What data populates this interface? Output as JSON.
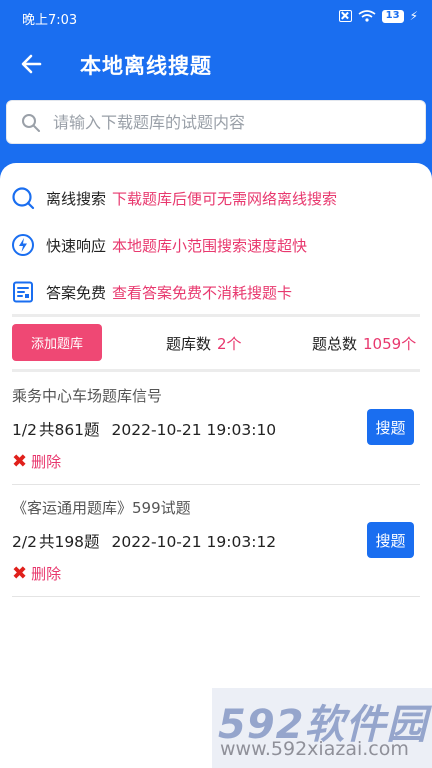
{
  "status_bar": {
    "time": "晚上7:03",
    "battery": "13"
  },
  "nav": {
    "title": "本地离线搜题"
  },
  "search": {
    "placeholder": "请输入下载题库的试题内容"
  },
  "features": [
    {
      "icon": "search-circle-icon",
      "name": "离线搜索",
      "desc": "下载题库后便可无需网络离线搜索"
    },
    {
      "icon": "lightning-icon",
      "name": "快速响应",
      "desc": "本地题库小范围搜索速度超快"
    },
    {
      "icon": "answer-sheet-icon",
      "name": "答案免费",
      "desc": "查看答案免费不消耗搜题卡"
    }
  ],
  "stats": {
    "add_label": "添加题库",
    "bank_count_label": "题库数",
    "bank_count_value": "2个",
    "total_label": "题总数",
    "total_value": "1059个"
  },
  "banks": [
    {
      "title": "乘务中心车场题库信号",
      "progress": "1/2",
      "count": "共861题",
      "datetime": "2022-10-21 19:03:10",
      "search_label": "搜题",
      "delete_label": "删除"
    },
    {
      "title": "《客运通用题库》599试题",
      "progress": "2/2",
      "count": "共198题",
      "datetime": "2022-10-21 19:03:12",
      "search_label": "搜题",
      "delete_label": "删除"
    }
  ],
  "watermark": {
    "logo": "592软件园",
    "url": "www.592xiazai.com"
  },
  "colors": {
    "primary": "#1a6ef0",
    "accent": "#e8386e",
    "add_button": "#ef4874",
    "delete_x": "#e0201b"
  }
}
